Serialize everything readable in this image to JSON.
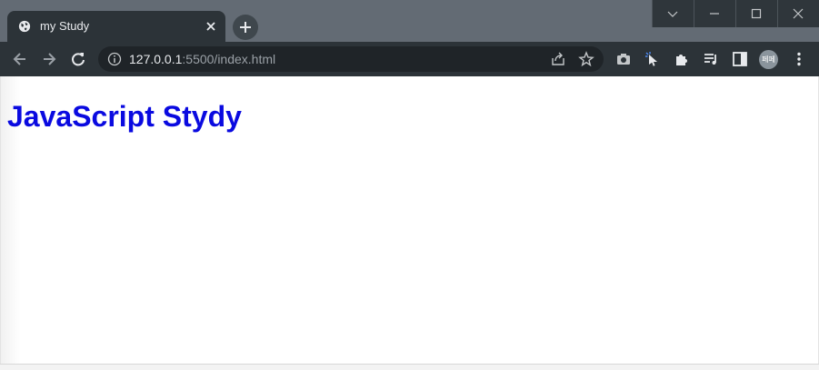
{
  "tab": {
    "title": "my Study"
  },
  "address_bar": {
    "host": "127.0.0.1",
    "path": ":5500/index.html"
  },
  "profile": {
    "initials": "페페"
  },
  "page": {
    "heading": "JavaScript Stydy"
  },
  "colors": {
    "heading": "#0a0ae0",
    "tabstrip": "#636b74",
    "toolbar": "#2c3338"
  },
  "icons": [
    "globe-icon",
    "close-icon",
    "plus-icon",
    "chevron-down-icon",
    "minimize-icon",
    "maximize-icon",
    "window-close-icon",
    "back-arrow-icon",
    "forward-arrow-icon",
    "reload-icon",
    "info-icon",
    "share-icon",
    "star-icon",
    "camera-icon",
    "cursor-icon",
    "puzzle-icon",
    "reading-list-icon",
    "side-panel-icon",
    "kebab-menu-icon"
  ]
}
